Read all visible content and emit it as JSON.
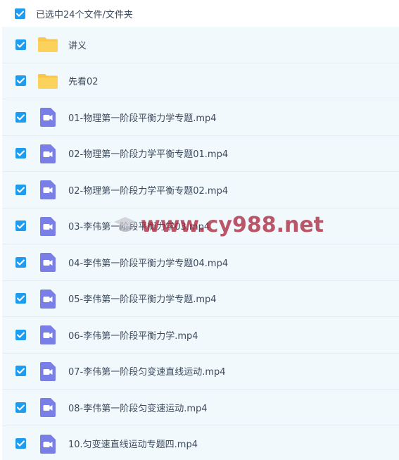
{
  "header": {
    "label": "已选中24个文件/文件夹",
    "checked": true
  },
  "items": [
    {
      "name": "讲义",
      "type": "folder",
      "checked": true
    },
    {
      "name": "先看02",
      "type": "folder",
      "checked": true
    },
    {
      "name": "01-物理第一阶段平衡力学专题.mp4",
      "type": "video",
      "checked": true
    },
    {
      "name": "02-物理第一阶段力学平衡专题01.mp4",
      "type": "video",
      "checked": true
    },
    {
      "name": "02-物理第一阶段力学平衡专题02.mp4",
      "type": "video",
      "checked": true
    },
    {
      "name": "03-李伟第一阶段平衡力学03.mp4",
      "type": "video",
      "checked": true
    },
    {
      "name": "04-李伟第一阶段平衡力学专题04.mp4",
      "type": "video",
      "checked": true
    },
    {
      "name": "05-李伟第一阶段平衡力学专题.mp4",
      "type": "video",
      "checked": true
    },
    {
      "name": "06-李伟第一阶段平衡力学.mp4",
      "type": "video",
      "checked": true
    },
    {
      "name": "07-李伟第一阶段匀变速直线运动.mp4",
      "type": "video",
      "checked": true
    },
    {
      "name": "08-李伟第一阶段匀变速运动.mp4",
      "type": "video",
      "checked": true
    },
    {
      "name": "10.匀变速直线运动专题四.mp4",
      "type": "video",
      "checked": true
    }
  ],
  "watermark": {
    "text": "www.cy988.net",
    "icon": "graduation-cap-icon"
  },
  "colors": {
    "checkbox": "#1e9cef",
    "folder": "#f9c84a",
    "video": "#7a7fe8",
    "row_background": "#f1f9fd"
  }
}
